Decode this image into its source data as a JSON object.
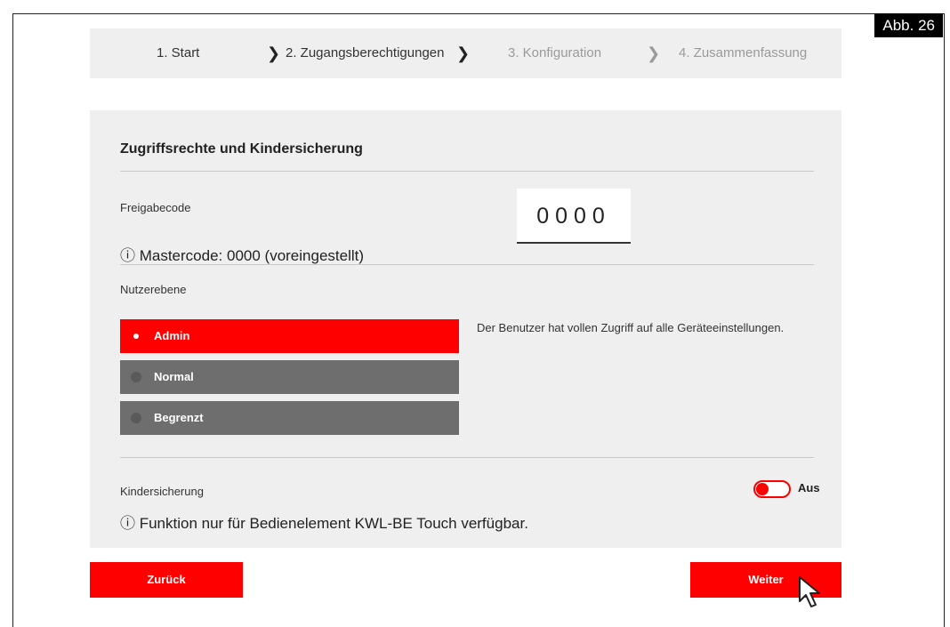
{
  "figure_tag": "Abb. 26",
  "stepper": {
    "steps": [
      {
        "label": "1. Start",
        "state": "done"
      },
      {
        "label": "2. Zugangsberechtigungen",
        "state": "active"
      },
      {
        "label": "3. Konfiguration",
        "state": "pending"
      },
      {
        "label": "4. Zusammenfassung",
        "state": "pending"
      }
    ],
    "chevron": "›"
  },
  "panel": {
    "title": "Zugriffsrechte und Kindersicherung",
    "unlock_code": {
      "label": "Freigabecode",
      "value": "0000",
      "info": "ⓘ Mastercode: 0000 (voreingestellt)"
    },
    "user_level": {
      "label": "Nutzerebene",
      "options": [
        "Admin",
        "Normal",
        "Begrenzt"
      ],
      "selected": "Admin",
      "description": "Der Benutzer hat vollen Zugriff auf alle Geräteeinstellungen."
    },
    "child_lock": {
      "label": "Kindersicherung",
      "toggle_state": "Aus",
      "info": "ⓘ Funktion nur für Bedienelement KWL-BE Touch verfügbar."
    }
  },
  "footer": {
    "back_label": "Zurück",
    "next_label": "Weiter"
  },
  "colors": {
    "accent": "#ff0000",
    "panel_bg": "#efefef",
    "inactive_option": "#6e6e6e"
  }
}
